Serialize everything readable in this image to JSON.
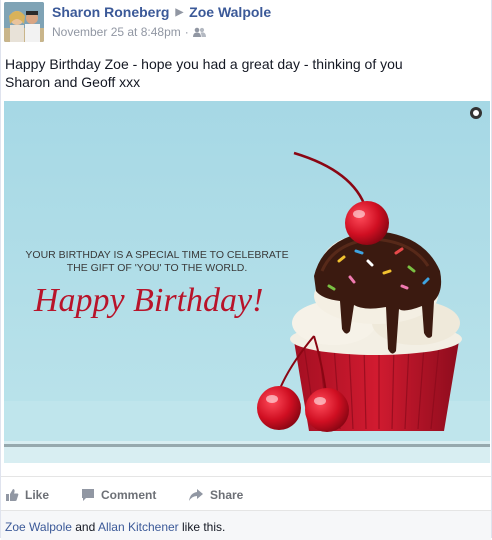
{
  "post": {
    "author": "Sharon Roneberg",
    "recipient": "Zoe Walpole",
    "timestamp": "November 25 at 8:48pm",
    "audience_icon": "friends-icon",
    "text_line1": "Happy Birthday Zoe - hope you had a great day - thinking of you",
    "text_line2": "Sharon and Geoff xxx"
  },
  "photo": {
    "caption_line1": "YOUR BIRTHDAY IS A SPECIAL TIME TO CELEBRATE",
    "caption_line2": "THE GIFT OF 'YOU' TO THE WORLD.",
    "script_text": "Happy Birthday!",
    "background_color": "#a9dbe6",
    "accent_color": "#b8142a"
  },
  "actions": {
    "like_label": "Like",
    "comment_label": "Comment",
    "share_label": "Share"
  },
  "likes": {
    "person1": "Zoe Walpole",
    "and_text": " and ",
    "person2": "Allan Kitchener",
    "suffix": " like this."
  },
  "colors": {
    "link": "#3b5998",
    "meta": "#9197a3",
    "action": "#6d7076"
  }
}
